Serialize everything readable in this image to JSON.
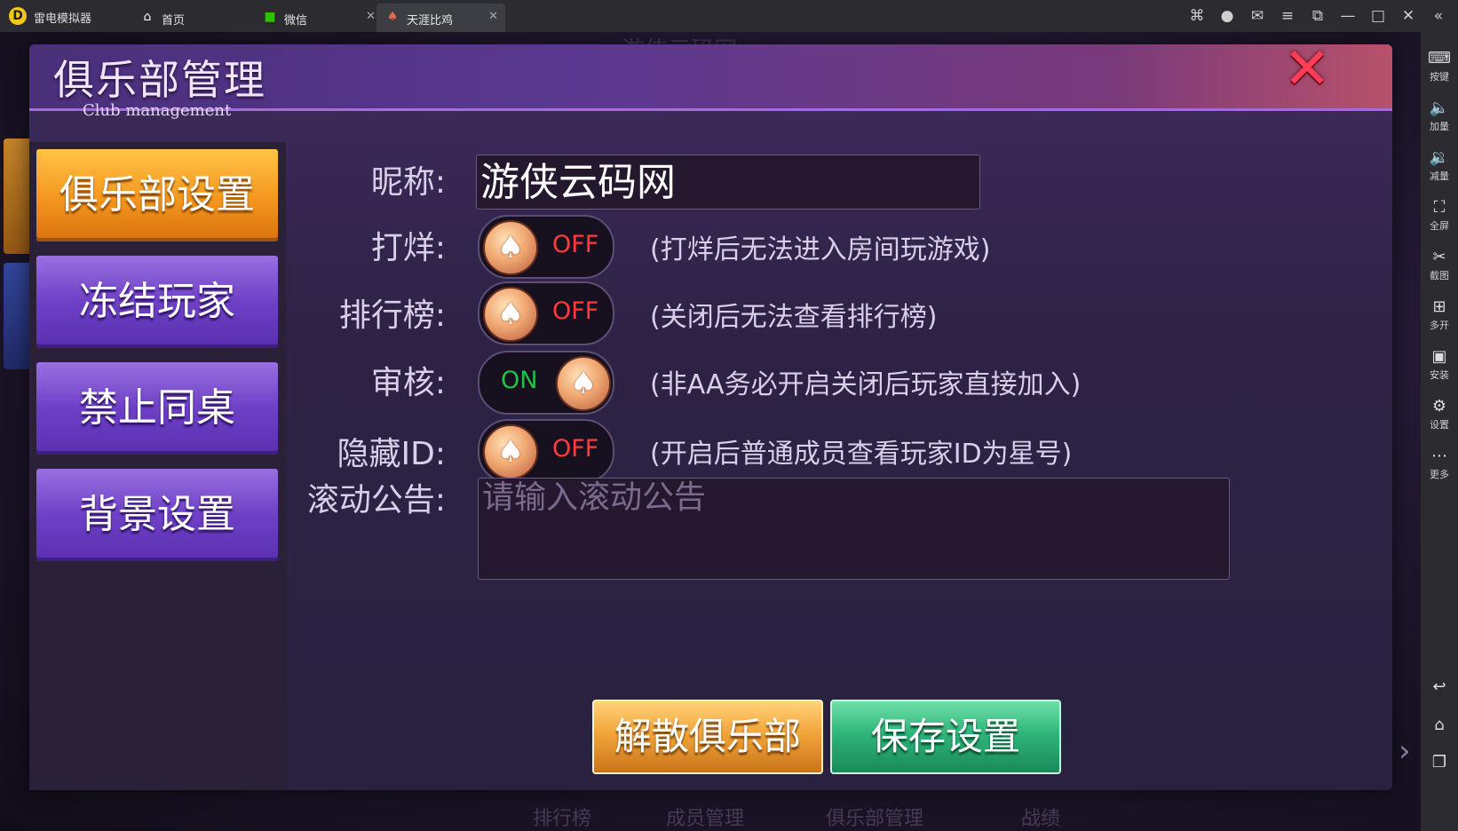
{
  "titlebar": {
    "app_name": "雷电模拟器",
    "tabs": [
      {
        "icon": "home-icon",
        "label": "首页",
        "closable": false,
        "active": false
      },
      {
        "icon": "wechat-icon",
        "label": "微信",
        "closable": true,
        "active": false
      },
      {
        "icon": "game-icon",
        "label": "天涯比鸡",
        "closable": true,
        "active": true
      }
    ]
  },
  "sidebar": {
    "items": [
      {
        "label": "按键",
        "icon": "keyboard-icon"
      },
      {
        "label": "加量",
        "icon": "volume-up-icon"
      },
      {
        "label": "减量",
        "icon": "volume-down-icon"
      },
      {
        "label": "全屏",
        "icon": "fullscreen-icon"
      },
      {
        "label": "截图",
        "icon": "scissors-icon"
      },
      {
        "label": "多开",
        "icon": "multi-instance-icon"
      },
      {
        "label": "安装",
        "icon": "apk-icon"
      },
      {
        "label": "设置",
        "icon": "gear-icon"
      },
      {
        "label": "更多",
        "icon": "more-icon"
      }
    ]
  },
  "background": {
    "top_text": "游侠云码网",
    "bottom_items": [
      "排行榜",
      "成员管理",
      "俱乐部管理",
      "战绩"
    ]
  },
  "dialog": {
    "title": "俱乐部管理",
    "subtitle": "Club management",
    "menu": [
      {
        "label": "俱乐部设置",
        "active": true
      },
      {
        "label": "冻结玩家",
        "active": false
      },
      {
        "label": "禁止同桌",
        "active": false
      },
      {
        "label": "背景设置",
        "active": false
      }
    ],
    "form": {
      "nickname_label": "昵称:",
      "nickname_value": "游侠云码网",
      "closed_label": "打烊:",
      "closed_state": "OFF",
      "closed_hint": "(打烊后无法进入房间玩游戏)",
      "ranking_label": "排行榜:",
      "ranking_state": "OFF",
      "ranking_hint": "(关闭后无法查看排行榜)",
      "review_label": "审核:",
      "review_state": "ON",
      "review_hint": "(非AA务必开启关闭后玩家直接加入)",
      "hide_id_label": "隐藏ID:",
      "hide_id_state": "OFF",
      "hide_id_hint": "(开启后普通成员查看玩家ID为星号)",
      "notice_label": "滚动公告:",
      "notice_placeholder": "请输入滚动公告"
    },
    "buttons": {
      "dissolve": "解散俱乐部",
      "save": "保存设置"
    }
  },
  "colors": {
    "toggle_off": "#ff3b3b",
    "toggle_on": "#22c244",
    "active_menu": "#f3961d",
    "menu": "#6e40c6",
    "close": "#ff3d56"
  }
}
